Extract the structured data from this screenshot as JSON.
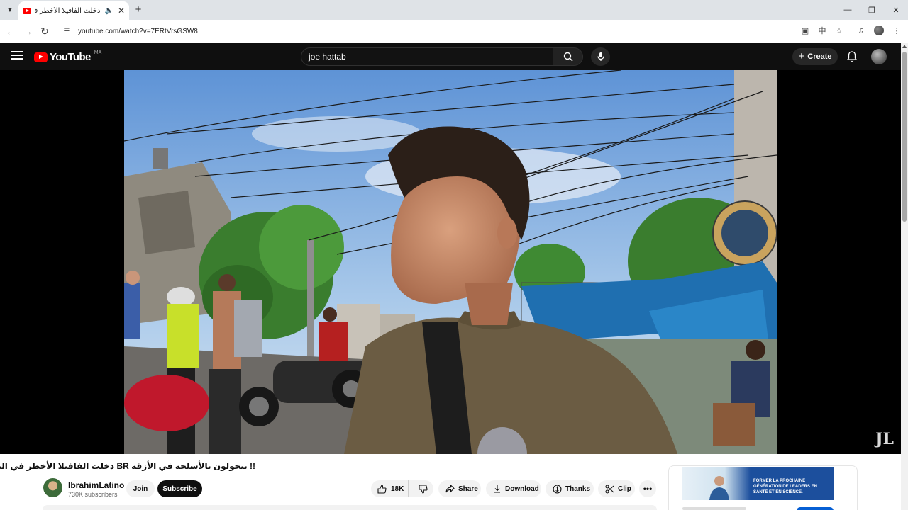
{
  "browser": {
    "tab_title": "دخلت الفافيلا الأخطر في البرا",
    "url": "youtube.com/watch?v=7ERtVrsGSW8"
  },
  "masthead": {
    "logo_text": "YouTube",
    "region": "MA",
    "search_value": "joe hattab",
    "create_label": "Create"
  },
  "video": {
    "title": "!! يتجولون بالأسلحة في الأزقة BR دخلت الفافيلا الأخطر في البرازيل",
    "watermark": "JL"
  },
  "channel": {
    "name": "IbrahimLatino",
    "subscribers": "730K subscribers",
    "join_label": "Join",
    "subscribe_label": "Subscribe"
  },
  "actions": {
    "likes": "18K",
    "share": "Share",
    "download": "Download",
    "thanks": "Thanks",
    "clip": "Clip"
  },
  "ad": {
    "text": "FORMER LA PROCHAINE GÉNÉRATION DE LEADERS EN SANTÉ ET EN SCIENCE."
  },
  "colors": {
    "youtube_red": "#ff0000",
    "masthead_bg": "#0f0f0f",
    "subscribe_bg": "#0f0f0f",
    "ad_blue": "#1c4f9d"
  }
}
